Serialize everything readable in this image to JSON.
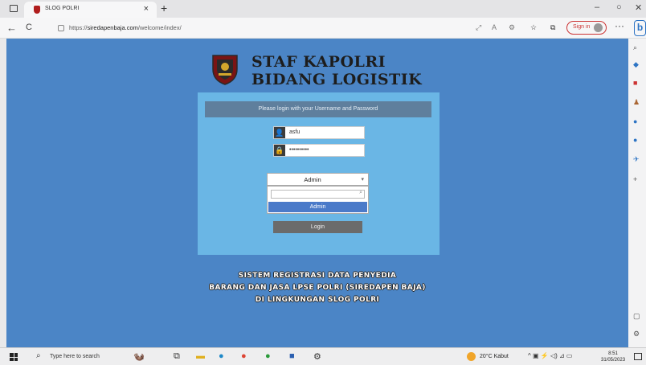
{
  "browser": {
    "tab_title": "SLOG POLRI",
    "tab_close": "×",
    "new_tab": "+",
    "url_prefix": "https://",
    "url_host": "siredapenbaja.com",
    "url_path": "/welcome/index/",
    "sign_in": "Sign in",
    "menu": "···",
    "bing": "b",
    "window_controls": {
      "minimize": "–",
      "maximize": "○",
      "close": "✕"
    },
    "nav": {
      "back": "←",
      "refresh": "C"
    }
  },
  "header": {
    "line1": "STAF KAPOLRI",
    "line2": "BIDANG LOGISTIK"
  },
  "login": {
    "prompt": "Please login with your Username and Password",
    "username": "asfu",
    "password": "••••••••••",
    "role_selected": "Admin",
    "dropdown_option": "Admin",
    "button": "Login"
  },
  "footer": {
    "line1": "SISTEM REGISTRASI DATA PENYEDIA",
    "line2": "BARANG DAN JASA LPSE POLRI (SIREDAPEN BAJA)",
    "line3": "DI LINGKUNGAN SLOG POLRI"
  },
  "taskbar": {
    "search_placeholder": "Type here to search",
    "weather": "20°C Kabut",
    "time": "8:51",
    "date": "31/05/2023"
  },
  "colors": {
    "page_bg": "#4b85c6",
    "panel_bg": "#6ab6e5",
    "panel_header": "#5f7f9d",
    "selected_option": "#4a7ac9",
    "login_button": "#6b6b6b"
  }
}
